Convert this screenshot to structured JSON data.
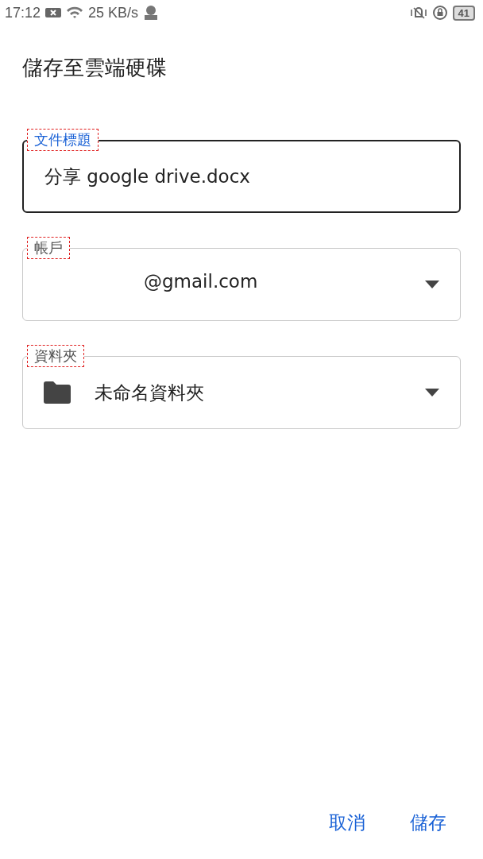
{
  "status_bar": {
    "time": "17:12",
    "speed": "25 KB/s",
    "battery": "41"
  },
  "dialog": {
    "title": "儲存至雲端硬碟",
    "fields": [
      {
        "kind": "text",
        "label": "文件標題",
        "value": "分享 google drive.docx",
        "focused": true,
        "annotated": true
      },
      {
        "kind": "account",
        "label": "帳戶",
        "value": "@gmail.com",
        "focused": false,
        "annotated": true
      },
      {
        "kind": "folder",
        "label": "資料夾",
        "value": "未命名資料夾",
        "focused": false,
        "annotated": true
      }
    ],
    "buttons": [
      "取消",
      "儲存"
    ]
  }
}
